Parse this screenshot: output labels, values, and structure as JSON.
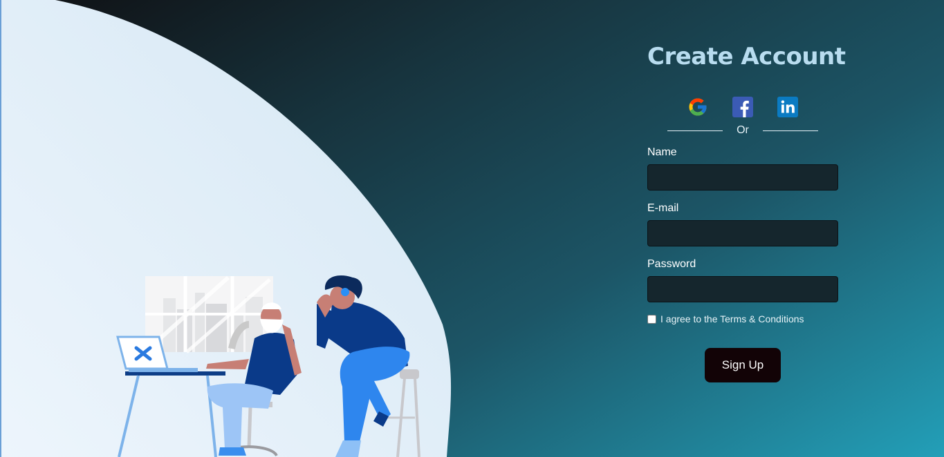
{
  "form": {
    "title": "Create Account",
    "divider_text": "Or",
    "name_label": "Name",
    "email_label": "E-mail",
    "password_label": "Password",
    "terms_text": "I agree to the Terms & Conditions",
    "submit_label": "Sign Up"
  },
  "socials": [
    {
      "icon": "google-icon",
      "color": "#4285f4"
    },
    {
      "icon": "facebook-icon",
      "color": "#3b5bb5"
    },
    {
      "icon": "linkedin-icon",
      "color": "#0b7bc2"
    }
  ],
  "colors": {
    "title": "#b8dcef",
    "input_bg": "#15262d",
    "button_bg": "#120306",
    "illustration_bg": "#dcecf7"
  }
}
